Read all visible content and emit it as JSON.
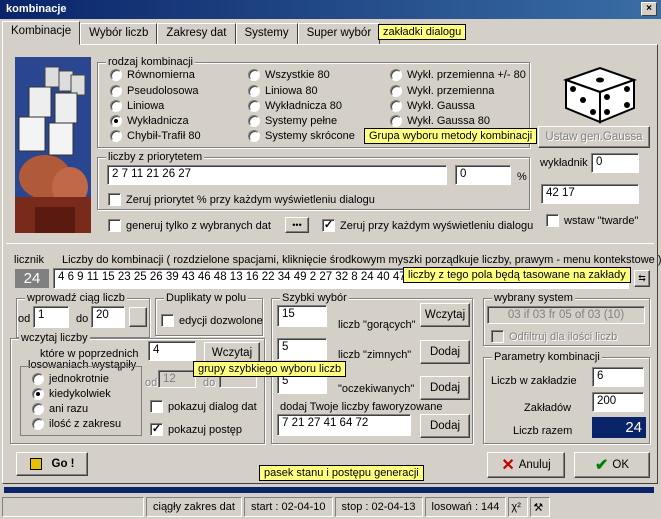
{
  "window": {
    "title": "kombinacje",
    "close": "×"
  },
  "tabs": [
    "Kombinacje",
    "Wybór liczb",
    "Zakresy dat",
    "Systemy",
    "Super wybór"
  ],
  "tips": {
    "tabs": "zakładki dialogu",
    "method": "Grupa wyboru metody kombinacji",
    "numbers": "liczby z tego pola będą tasowane na zakłady",
    "quick": "grupy szybkiego wyboru liczb",
    "status": "pasek stanu i postępu generacji"
  },
  "rodzaj": {
    "label": "rodzaj kombinacji",
    "col1": [
      "Równomierna",
      "Pseudolosowa",
      "Liniowa",
      "Wykładnicza",
      "Chybił-Trafił 80"
    ],
    "col2": [
      "Wszystkie 80",
      "Liniowa 80",
      "Wykładnicza 80",
      "Systemy pełne",
      "Systemy skrócone"
    ],
    "col3": [
      "Wykł. przemienna +/- 80",
      "Wykł. przemienna",
      "Wykł. Gaussa",
      "Wykł. Gaussa 80"
    ]
  },
  "gauss_button": "Ustaw gen.Gaussa",
  "wykladnik": {
    "label": "wykładnik",
    "value": "0",
    "value2": "42 17"
  },
  "wstaw": "wstaw \"twarde\"",
  "priorytet": {
    "label": "liczby z priorytetem",
    "value": "2 7 11 21 26 27",
    "pct": "0",
    "pct_unit": "%",
    "check": "Zeruj priorytet % przy każdym wyświetleniu dialogu"
  },
  "generuj": "generuj tylko z wybranych dat",
  "dots": "•••",
  "zeruj": "Zeruj przy każdym wyświetleniu dialogu",
  "licznik": {
    "label": "licznik",
    "value": "24"
  },
  "liczby": {
    "label": "Liczby do kombinacji ( rozdzielone spacjami, kliknięcie środkowym myszki porządkuje liczby, prawym - menu kontekstowe )",
    "value": "4 6 9 11 15 23 25 26 39 43 46 48 13 16 22 34 49 2 27 32 8 24 40 47"
  },
  "wprowadz": {
    "label": "wprowadź ciąg liczb",
    "od": "od",
    "od_val": "1",
    "do": "do",
    "do_val": "20"
  },
  "duplikaty": {
    "label": "Duplikaty w polu",
    "check": "edycji dozwolone"
  },
  "wczytaj": {
    "label": "wczytaj liczby",
    "line1": "które w poprzednich",
    "line2": "losowaniach wystąpiły",
    "value": "4",
    "button": "Wczytaj",
    "od": "od",
    "od_val": "12",
    "do": "do",
    "opts": [
      "jednokrotnie",
      "kiedykolwiek",
      "ani razu",
      "ilość z zakresu"
    ],
    "dialog": "pokazuj dialog dat",
    "postep": "pokazuj postęp"
  },
  "szybki": {
    "label": "Szybki wybór",
    "hot_val": "15",
    "hot": "liczb \"gorących\"",
    "cold_val": "5",
    "cold": "liczb \"zimnych\"",
    "exp_val": "5",
    "exp": "\"oczekiwanych\"",
    "fav_label": "dodaj Twoje liczby faworyzowane",
    "fav_val": "7 21 27 41 64 72",
    "btn_load": "Wczytaj",
    "btn_add": "Dodaj"
  },
  "system": {
    "label": "wybrany system",
    "value": "03 if 03 fr 05 of 03 (10)",
    "check": "Odfiltruj dla ilości liczb"
  },
  "param": {
    "label": "Parametry kombinacji",
    "liczb": "Liczb w zakładzie",
    "liczb_val": "6",
    "zakl": "Zakładów",
    "zakl_val": "200",
    "razem": "Liczb razem",
    "razem_val": "24"
  },
  "go": "Go !",
  "anuluj": "Anuluj",
  "ok": "OK",
  "status": {
    "c1": "ciągły zakres dat",
    "c2": "start : 02-04-10",
    "c3": "stop : 02-04-13",
    "c4": "losowań : 144"
  },
  "colors": {
    "title": "#0a246a",
    "progress": "#0a246a",
    "razem_bg": "#0a246a"
  }
}
